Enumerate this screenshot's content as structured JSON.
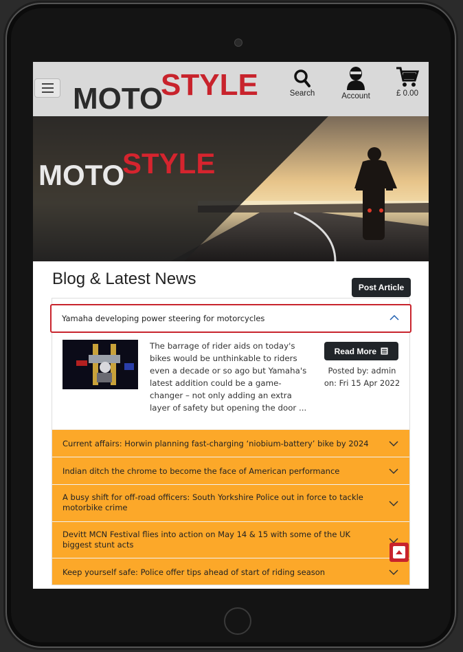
{
  "header": {
    "logo_moto": "MOTO",
    "logo_style": "STYLE",
    "search_label": "Search",
    "account_label": "Account",
    "cart_total": "£ 0.00"
  },
  "hero": {
    "logo_moto": "MOTO",
    "logo_style": "STYLE"
  },
  "blog": {
    "title": "Blog & Latest News",
    "post_article_label": "Post Article",
    "open_article": {
      "title": "Yamaha developing power steering for motorcycles",
      "excerpt": "The barrage of rider aids on today's bikes would be unthinkable to riders even a decade or so ago but Yamaha's latest addition could be a game-changer – not only adding an extra layer of safety but opening the door ...",
      "read_more_label": "Read More",
      "posted_by": "Posted by: admin",
      "posted_on": "on: Fri 15 Apr 2022"
    },
    "articles": [
      "Current affairs: Horwin planning fast-charging ‘niobium-battery’ bike by 2024",
      "Indian ditch the chrome to become the face of American performance",
      "A busy shift for off-road officers: South Yorkshire Police out in force to tackle motorbike crime",
      "Devitt MCN Festival flies into action on May 14 & 15 with some of the UK biggest stunt acts",
      "Keep yourself safe: Police offer tips ahead of start of riding season"
    ]
  },
  "colors": {
    "brand_red": "#c8232c",
    "accordion_orange": "#fca829",
    "dark_button": "#212529"
  }
}
